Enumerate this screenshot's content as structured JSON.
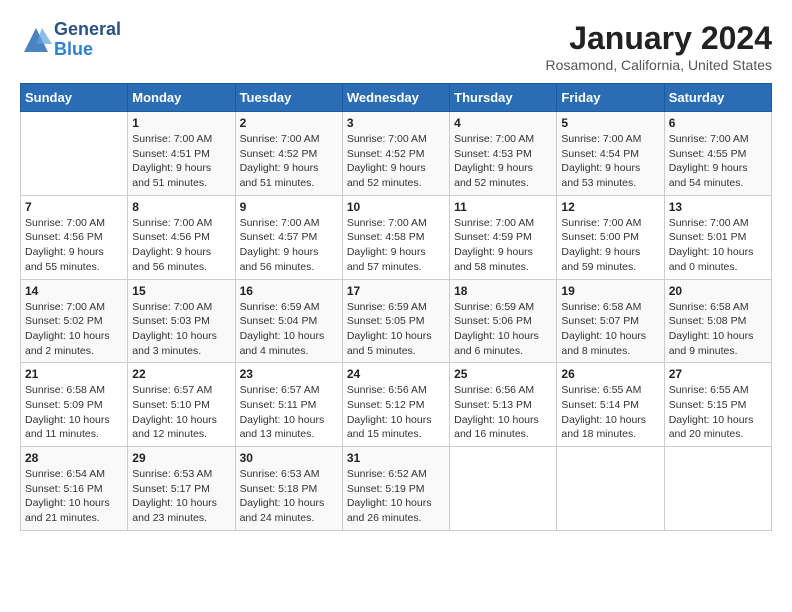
{
  "header": {
    "logo_line1": "General",
    "logo_line2": "Blue",
    "title": "January 2024",
    "location": "Rosamond, California, United States"
  },
  "days_of_week": [
    "Sunday",
    "Monday",
    "Tuesday",
    "Wednesday",
    "Thursday",
    "Friday",
    "Saturday"
  ],
  "weeks": [
    [
      {
        "num": "",
        "info": ""
      },
      {
        "num": "1",
        "info": "Sunrise: 7:00 AM\nSunset: 4:51 PM\nDaylight: 9 hours\nand 51 minutes."
      },
      {
        "num": "2",
        "info": "Sunrise: 7:00 AM\nSunset: 4:52 PM\nDaylight: 9 hours\nand 51 minutes."
      },
      {
        "num": "3",
        "info": "Sunrise: 7:00 AM\nSunset: 4:52 PM\nDaylight: 9 hours\nand 52 minutes."
      },
      {
        "num": "4",
        "info": "Sunrise: 7:00 AM\nSunset: 4:53 PM\nDaylight: 9 hours\nand 52 minutes."
      },
      {
        "num": "5",
        "info": "Sunrise: 7:00 AM\nSunset: 4:54 PM\nDaylight: 9 hours\nand 53 minutes."
      },
      {
        "num": "6",
        "info": "Sunrise: 7:00 AM\nSunset: 4:55 PM\nDaylight: 9 hours\nand 54 minutes."
      }
    ],
    [
      {
        "num": "7",
        "info": "Sunrise: 7:00 AM\nSunset: 4:56 PM\nDaylight: 9 hours\nand 55 minutes."
      },
      {
        "num": "8",
        "info": "Sunrise: 7:00 AM\nSunset: 4:56 PM\nDaylight: 9 hours\nand 56 minutes."
      },
      {
        "num": "9",
        "info": "Sunrise: 7:00 AM\nSunset: 4:57 PM\nDaylight: 9 hours\nand 56 minutes."
      },
      {
        "num": "10",
        "info": "Sunrise: 7:00 AM\nSunset: 4:58 PM\nDaylight: 9 hours\nand 57 minutes."
      },
      {
        "num": "11",
        "info": "Sunrise: 7:00 AM\nSunset: 4:59 PM\nDaylight: 9 hours\nand 58 minutes."
      },
      {
        "num": "12",
        "info": "Sunrise: 7:00 AM\nSunset: 5:00 PM\nDaylight: 9 hours\nand 59 minutes."
      },
      {
        "num": "13",
        "info": "Sunrise: 7:00 AM\nSunset: 5:01 PM\nDaylight: 10 hours\nand 0 minutes."
      }
    ],
    [
      {
        "num": "14",
        "info": "Sunrise: 7:00 AM\nSunset: 5:02 PM\nDaylight: 10 hours\nand 2 minutes."
      },
      {
        "num": "15",
        "info": "Sunrise: 7:00 AM\nSunset: 5:03 PM\nDaylight: 10 hours\nand 3 minutes."
      },
      {
        "num": "16",
        "info": "Sunrise: 6:59 AM\nSunset: 5:04 PM\nDaylight: 10 hours\nand 4 minutes."
      },
      {
        "num": "17",
        "info": "Sunrise: 6:59 AM\nSunset: 5:05 PM\nDaylight: 10 hours\nand 5 minutes."
      },
      {
        "num": "18",
        "info": "Sunrise: 6:59 AM\nSunset: 5:06 PM\nDaylight: 10 hours\nand 6 minutes."
      },
      {
        "num": "19",
        "info": "Sunrise: 6:58 AM\nSunset: 5:07 PM\nDaylight: 10 hours\nand 8 minutes."
      },
      {
        "num": "20",
        "info": "Sunrise: 6:58 AM\nSunset: 5:08 PM\nDaylight: 10 hours\nand 9 minutes."
      }
    ],
    [
      {
        "num": "21",
        "info": "Sunrise: 6:58 AM\nSunset: 5:09 PM\nDaylight: 10 hours\nand 11 minutes."
      },
      {
        "num": "22",
        "info": "Sunrise: 6:57 AM\nSunset: 5:10 PM\nDaylight: 10 hours\nand 12 minutes."
      },
      {
        "num": "23",
        "info": "Sunrise: 6:57 AM\nSunset: 5:11 PM\nDaylight: 10 hours\nand 13 minutes."
      },
      {
        "num": "24",
        "info": "Sunrise: 6:56 AM\nSunset: 5:12 PM\nDaylight: 10 hours\nand 15 minutes."
      },
      {
        "num": "25",
        "info": "Sunrise: 6:56 AM\nSunset: 5:13 PM\nDaylight: 10 hours\nand 16 minutes."
      },
      {
        "num": "26",
        "info": "Sunrise: 6:55 AM\nSunset: 5:14 PM\nDaylight: 10 hours\nand 18 minutes."
      },
      {
        "num": "27",
        "info": "Sunrise: 6:55 AM\nSunset: 5:15 PM\nDaylight: 10 hours\nand 20 minutes."
      }
    ],
    [
      {
        "num": "28",
        "info": "Sunrise: 6:54 AM\nSunset: 5:16 PM\nDaylight: 10 hours\nand 21 minutes."
      },
      {
        "num": "29",
        "info": "Sunrise: 6:53 AM\nSunset: 5:17 PM\nDaylight: 10 hours\nand 23 minutes."
      },
      {
        "num": "30",
        "info": "Sunrise: 6:53 AM\nSunset: 5:18 PM\nDaylight: 10 hours\nand 24 minutes."
      },
      {
        "num": "31",
        "info": "Sunrise: 6:52 AM\nSunset: 5:19 PM\nDaylight: 10 hours\nand 26 minutes."
      },
      {
        "num": "",
        "info": ""
      },
      {
        "num": "",
        "info": ""
      },
      {
        "num": "",
        "info": ""
      }
    ]
  ]
}
